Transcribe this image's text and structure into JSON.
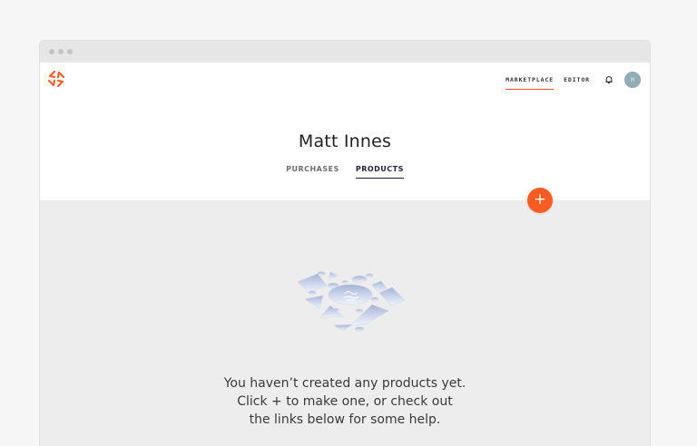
{
  "nav": {
    "marketplace": "MARKETPLACE",
    "editor": "EDITOR",
    "avatar_initial": "M",
    "bell_icon": "bell-icon"
  },
  "profile": {
    "name": "Matt Innes"
  },
  "tabs": [
    {
      "label": "PURCHASES",
      "active": false
    },
    {
      "label": "PRODUCTS",
      "active": true
    }
  ],
  "fab": {
    "label": "+"
  },
  "empty_state": {
    "line1": "You haven’t created any products yet.",
    "line2": "Click + to make one, or check out",
    "line3": "the links below for some help."
  },
  "colors": {
    "accent": "#ff5a1f",
    "avatar_bg": "#90acb4",
    "active_tab": "#1f1f3d",
    "content_bg": "#ededed"
  }
}
